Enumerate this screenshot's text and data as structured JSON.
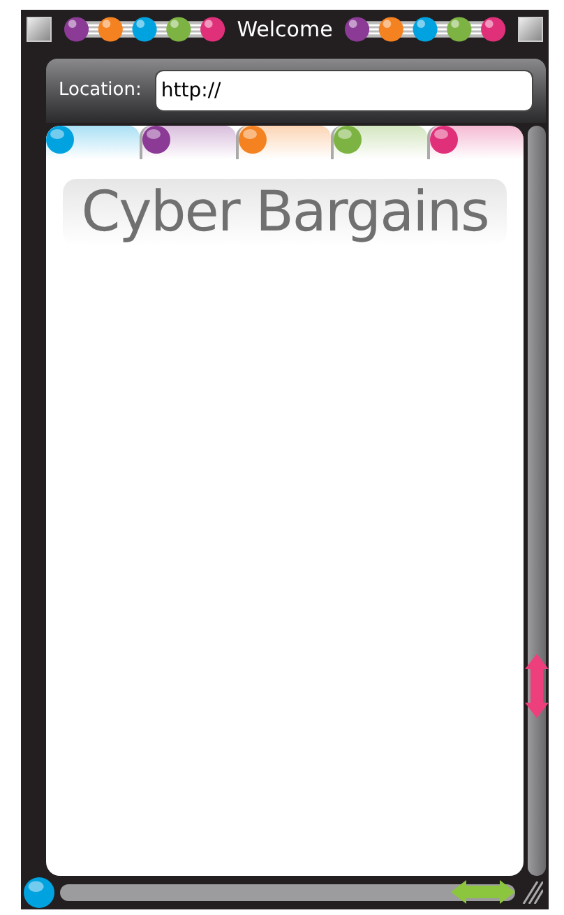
{
  "window": {
    "title": "Welcome"
  },
  "location": {
    "label": "Location:",
    "value": "http://"
  },
  "tabs": [
    {
      "color": "#00a3e0"
    },
    {
      "color": "#8b3a96"
    },
    {
      "color": "#f58220"
    },
    {
      "color": "#7cb342"
    },
    {
      "color": "#e0307a"
    }
  ],
  "page": {
    "logo": "Cyber Bargains"
  }
}
